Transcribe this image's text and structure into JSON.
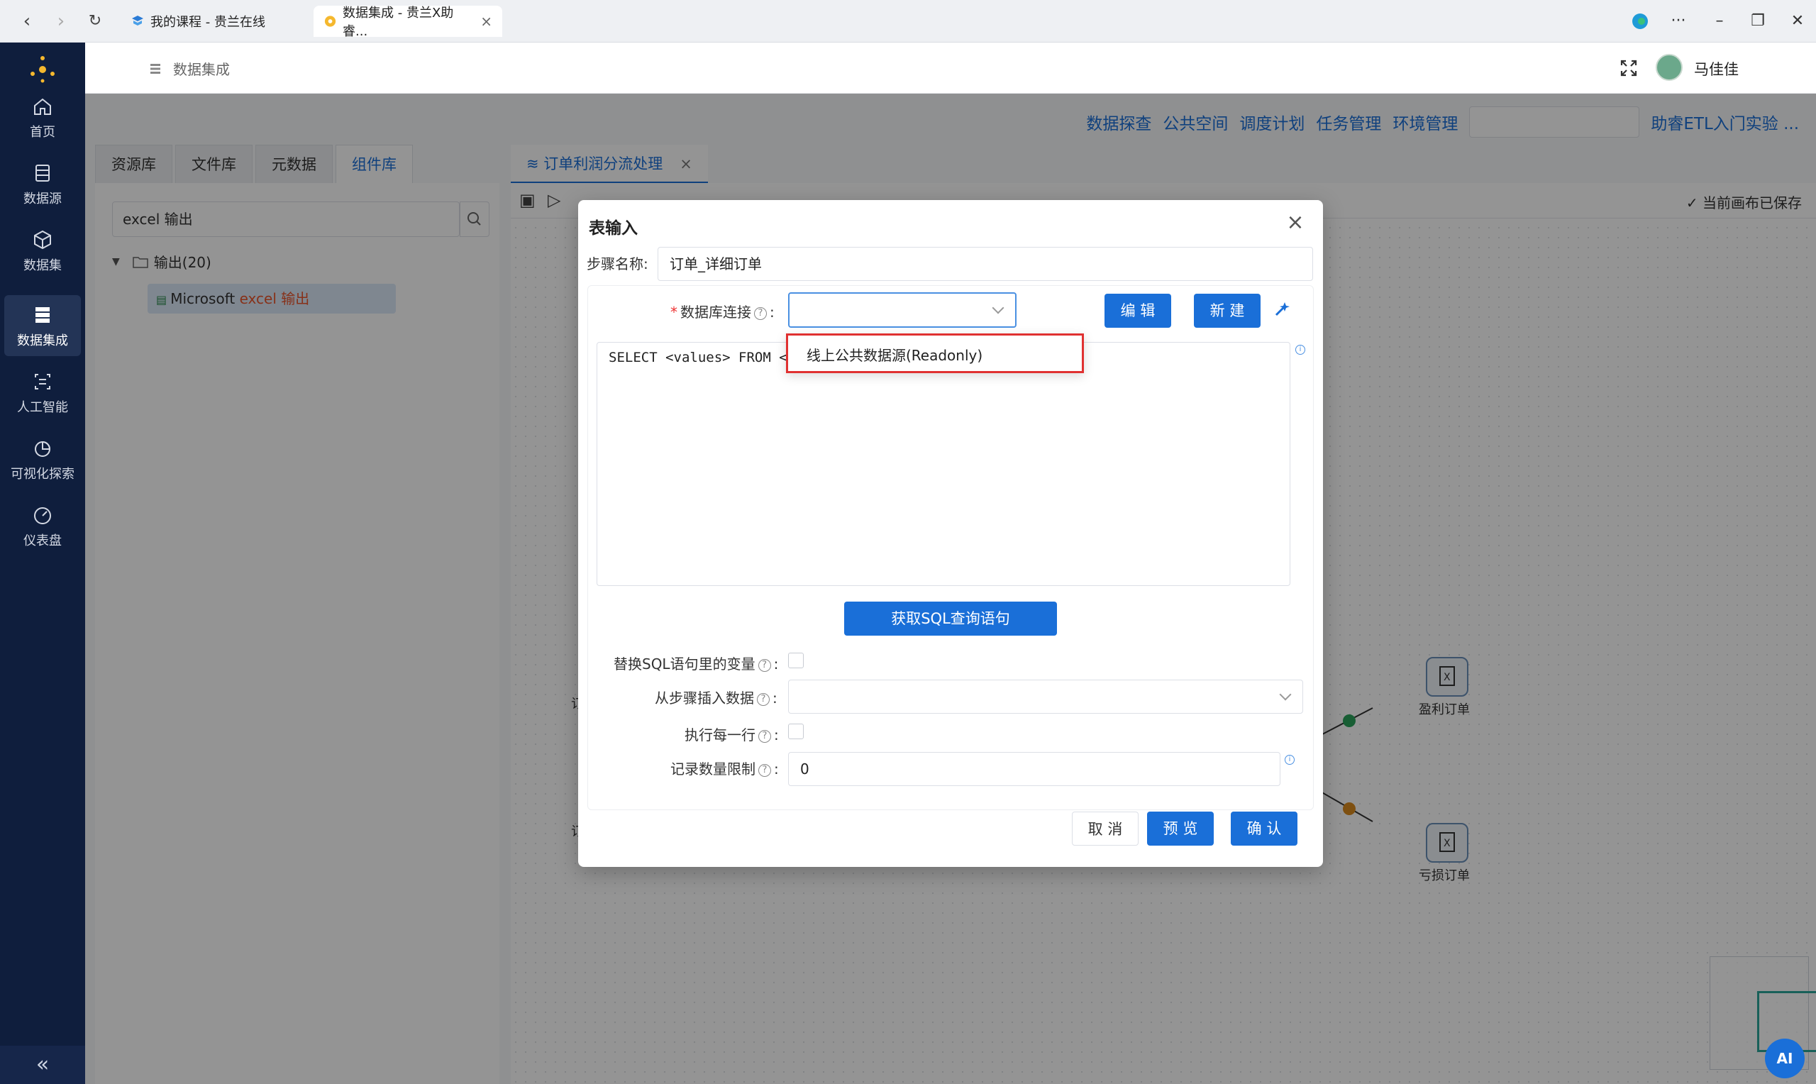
{
  "browser": {
    "tabs": [
      {
        "label": "我的课程 - 贵兰在线",
        "active": false
      },
      {
        "label": "数据集成 - 贵兰X助睿...",
        "active": true
      }
    ]
  },
  "sidebar": {
    "items": [
      {
        "label": "首页",
        "icon": "home-icon"
      },
      {
        "label": "数据源",
        "icon": "datasource-icon"
      },
      {
        "label": "数据集",
        "icon": "cube-icon"
      },
      {
        "label": "数据集成",
        "icon": "server-icon",
        "active": true
      },
      {
        "label": "人工智能",
        "icon": "ai-icon"
      },
      {
        "label": "可视化探索",
        "icon": "pie-chart-icon"
      },
      {
        "label": "仪表盘",
        "icon": "gauge-icon"
      }
    ],
    "collapse_label": "«"
  },
  "header": {
    "breadcrumb": "数据集成",
    "username": "马佳佳"
  },
  "top_links": [
    "数据探查",
    "公共空间",
    "调度计划",
    "任务管理",
    "环境管理"
  ],
  "project_name": "助睿ETL入门实验 ...",
  "left_panel": {
    "tabs": [
      "资源库",
      "文件库",
      "元数据",
      "组件库"
    ],
    "active_tab": 3,
    "search_value": "excel 输出",
    "tree_group": "输出(20)",
    "tree_leaf_prefix": "Microsoft ",
    "tree_leaf_highlight": "excel 输出"
  },
  "canvas": {
    "tab_label": "订单利润分流处理",
    "saved_status": "当前画布已保存",
    "nodes": [
      "盈利订单",
      "亏损订单"
    ],
    "partial_labels": [
      "订",
      "订"
    ]
  },
  "modal": {
    "title": "表输入",
    "step_name_label": "步骤名称:",
    "step_name_value": "订单_详细订单",
    "db_conn_label": "数据库连接",
    "edit_button": "编 辑",
    "new_button": "新 建",
    "sql_text": "SELECT <values> FROM <t",
    "get_sql_button": "获取SQL查询语句",
    "replace_vars_label": "替换SQL语句里的变量",
    "insert_from_step_label": "从步骤插入数据",
    "exec_each_row_label": "执行每一行",
    "limit_label": "记录数量限制",
    "limit_value": "0",
    "cancel_button": "取 消",
    "preview_button": "预 览",
    "confirm_button": "确 认",
    "dropdown_option": "线上公共数据源(Readonly)"
  },
  "ai_badge": "AI",
  "colors": {
    "accent": "#1a6fd8",
    "sidebar": "#0f1e3d",
    "highlight": "#e03131"
  }
}
